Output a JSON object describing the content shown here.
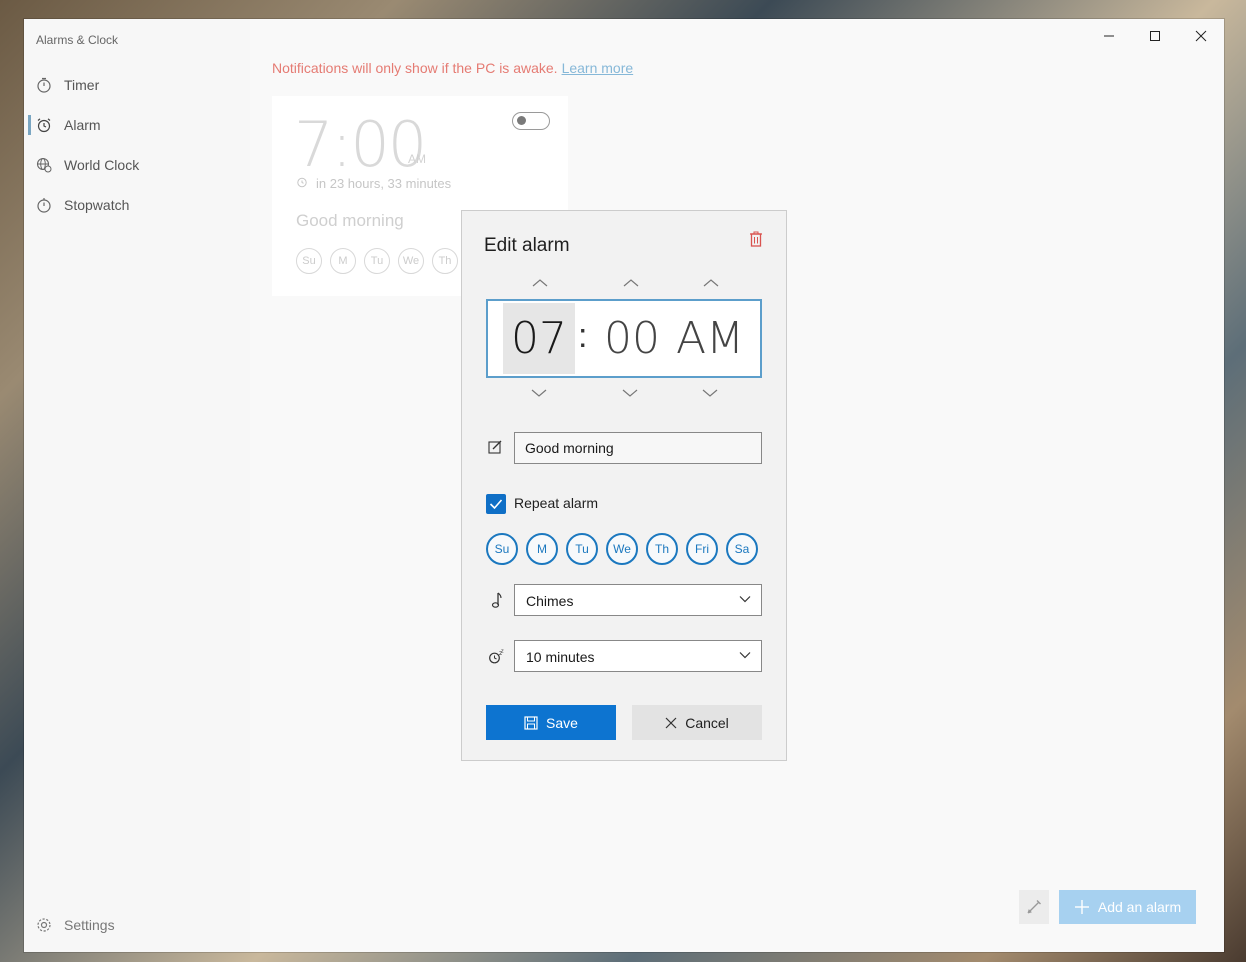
{
  "app": {
    "title": "Alarms & Clock"
  },
  "nav": {
    "items": [
      {
        "label": "Timer",
        "icon": "timer-icon"
      },
      {
        "label": "Alarm",
        "icon": "alarm-clock-icon"
      },
      {
        "label": "World Clock",
        "icon": "globe-icon"
      },
      {
        "label": "Stopwatch",
        "icon": "stopwatch-icon"
      }
    ],
    "settings_label": "Settings"
  },
  "notice": {
    "text": "Notifications will only show if the PC is awake.",
    "link": "Learn more"
  },
  "alarm_card": {
    "time": "7:00",
    "ampm": "AM",
    "countdown": "in 23 hours, 33 minutes",
    "name": "Good morning",
    "enabled": false,
    "days": [
      "Su",
      "M",
      "Tu",
      "We",
      "Th"
    ]
  },
  "edit_dialog": {
    "title": "Edit alarm",
    "hour": "07",
    "separator": ":",
    "minute": "00",
    "ampm": "AM",
    "alarm_name": "Good morning",
    "repeat_label": "Repeat alarm",
    "repeat_checked": true,
    "days": [
      "Su",
      "M",
      "Tu",
      "We",
      "Th",
      "Fri",
      "Sa"
    ],
    "sound": "Chimes",
    "snooze": "10 minutes",
    "save_label": "Save",
    "cancel_label": "Cancel"
  },
  "footer": {
    "add_label": "Add an alarm"
  },
  "colors": {
    "accent": "#0d74d0",
    "notice": "#e57b73",
    "link": "#86b8d8",
    "delete": "#d9534f"
  }
}
